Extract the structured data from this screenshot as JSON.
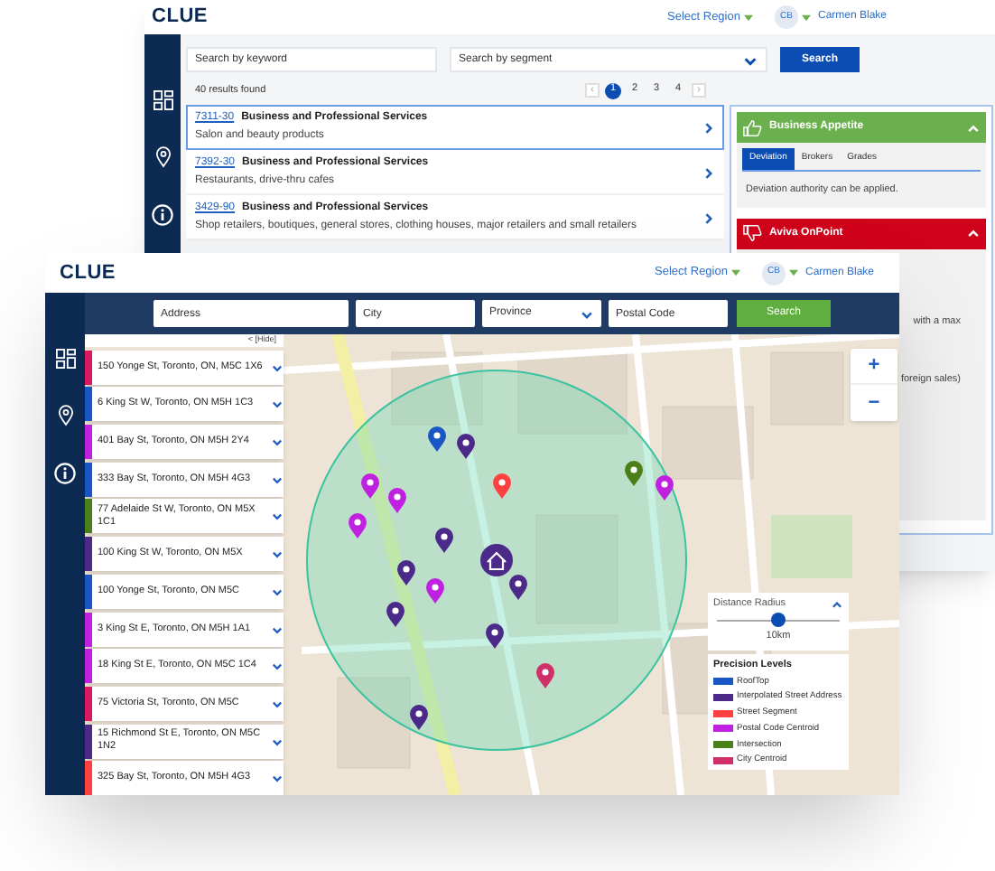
{
  "back_window": {
    "logo": "CLUE",
    "region_select": "Select Region",
    "user": {
      "initials": "CB",
      "name": "Carmen Blake"
    },
    "search": {
      "keyword_placeholder": "Search by keyword",
      "segment_placeholder": "Search by segment",
      "button": "Search"
    },
    "results_count": "40 results found",
    "pagination": {
      "prev": "‹",
      "next": "›",
      "pages": [
        {
          "label": "1",
          "selected": true
        },
        {
          "label": "2",
          "selected": false
        },
        {
          "label": "3",
          "selected": false
        },
        {
          "label": "4",
          "selected": false
        }
      ]
    },
    "results": [
      {
        "code": "7311-30",
        "title": "Business and Professional Services",
        "description": "Salon and beauty products",
        "selected": true
      },
      {
        "code": "7392-30",
        "title": "Business and Professional Services",
        "description": "Restaurants, drive-thru cafes",
        "selected": false
      },
      {
        "code": "3429-90",
        "title": "Business and Professional Services",
        "description": "Shop retailers, boutiques, general stores, clothing houses, major retailers and small retailers",
        "selected": false
      }
    ],
    "panels": [
      {
        "kind": "appetite",
        "title": "Business Appetite",
        "tabs": [
          {
            "label": "Deviation",
            "selected": true
          },
          {
            "label": "Brokers",
            "selected": false
          },
          {
            "label": "Grades",
            "selected": false
          }
        ],
        "text": "Deviation authority can be applied."
      },
      {
        "kind": "onpoint",
        "title": "Aviva OnPoint",
        "lines": [
          "with a max",
          "foreign sales)"
        ]
      }
    ]
  },
  "front_window": {
    "logo": "CLUE",
    "region_select": "Select Region",
    "user": {
      "initials": "CB",
      "name": "Carmen Blake"
    },
    "fields": [
      {
        "kind": "text",
        "placeholder": "Address"
      },
      {
        "kind": "text",
        "placeholder": "City"
      },
      {
        "kind": "select",
        "placeholder": "Province"
      },
      {
        "kind": "text",
        "placeholder": "Postal Code"
      }
    ],
    "search_button": "Search",
    "hide_toggle": "< [Hide]",
    "locations": [
      {
        "address": "150 Yonge St, Toronto, ON, M5C 1X6",
        "color": "#d81b60"
      },
      {
        "address": "6 King St W, Toronto, ON M5H 1C3",
        "color": "#1a56c4"
      },
      {
        "address": "401 Bay St, Toronto, ON M5H 2Y4",
        "color": "#c020e0"
      },
      {
        "address": "333 Bay St, Toronto, ON M5H 4G3",
        "color": "#1a56c4"
      },
      {
        "address": "77 Adelaide St W, Toronto, ON M5X 1C1",
        "color": "#4a7f1a"
      },
      {
        "address": "100 King St W, Toronto, ON M5X",
        "color": "#4b2a8a"
      },
      {
        "address": "100 Yonge St, Toronto, ON M5C",
        "color": "#1a56c4"
      },
      {
        "address": "3 King St E, Toronto, ON M5H 1A1",
        "color": "#c020e0"
      },
      {
        "address": "18 King St E, Toronto, ON M5C 1C4",
        "color": "#c020e0"
      },
      {
        "address": "75 Victoria St, Toronto, ON M5C",
        "color": "#d81b60"
      },
      {
        "address": "15 Richmond St E, Toronto, ON M5C 1N2",
        "color": "#4b2a8a"
      },
      {
        "address": "325 Bay St, Toronto, ON M5H 4G3",
        "color": "#ff4040"
      }
    ],
    "zoom": {
      "in": "+",
      "out": "−"
    },
    "distance": {
      "title": "Distance Radius",
      "level": 0.5,
      "reading": "10km"
    },
    "legend": {
      "title": "Precision Levels",
      "items": [
        {
          "label": "RoofTop",
          "color": "#1a56c4"
        },
        {
          "label": "Interpolated Street Address",
          "color": "#4b2a8a"
        },
        {
          "label": "Street Segment",
          "color": "#ff4040"
        },
        {
          "label": "Postal Code Centroid",
          "color": "#c020e0"
        },
        {
          "label": "Intersection",
          "color": "#4a7f1a"
        },
        {
          "label": "City Centroid",
          "color": "#d0306a"
        }
      ]
    }
  }
}
